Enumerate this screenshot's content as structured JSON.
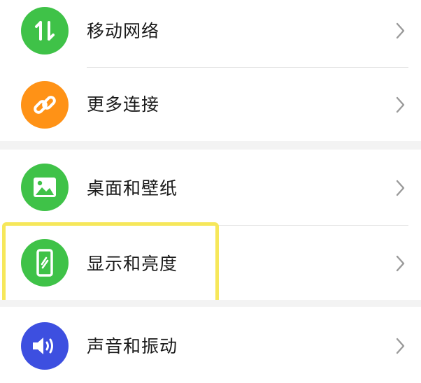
{
  "settings": {
    "items": [
      {
        "label": "移动网络",
        "icon": "data-transfer-icon",
        "color": "#3fc248"
      },
      {
        "label": "更多连接",
        "icon": "link-icon",
        "color": "#ff9216"
      },
      {
        "label": "桌面和壁纸",
        "icon": "image-icon",
        "color": "#3fc248"
      },
      {
        "label": "显示和亮度",
        "icon": "phone-brightness-icon",
        "color": "#3fc248"
      },
      {
        "label": "声音和振动",
        "icon": "speaker-icon",
        "color": "#3d4fe0"
      }
    ]
  },
  "colors": {
    "highlight": "#f6e75a",
    "section_gap": "#f3f3f3",
    "divider": "#e6e6e6",
    "chevron": "#9a9a9a"
  }
}
